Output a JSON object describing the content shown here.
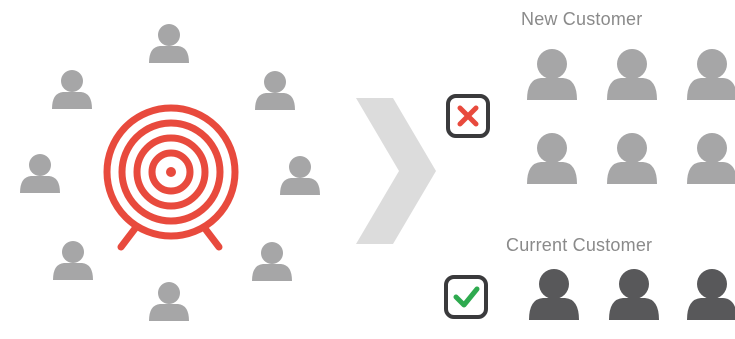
{
  "sections": {
    "new": {
      "title": "New Customer",
      "status": "rejected",
      "status_icon": "x-icon",
      "status_color": "#e84a3d"
    },
    "current": {
      "title": "Current Customer",
      "status": "accepted",
      "status_icon": "check-icon",
      "status_color": "#2eaa4f"
    }
  },
  "colors": {
    "target_red": "#e84a3d",
    "person_light": "#a6a6a7",
    "person_dark": "#58585a",
    "chevron": "#dcdcdc",
    "box_border": "#3a3a3c"
  },
  "icons": {
    "target": "bullseye-target-icon",
    "person": "person-icon",
    "arrow": "chevron-right-icon"
  }
}
